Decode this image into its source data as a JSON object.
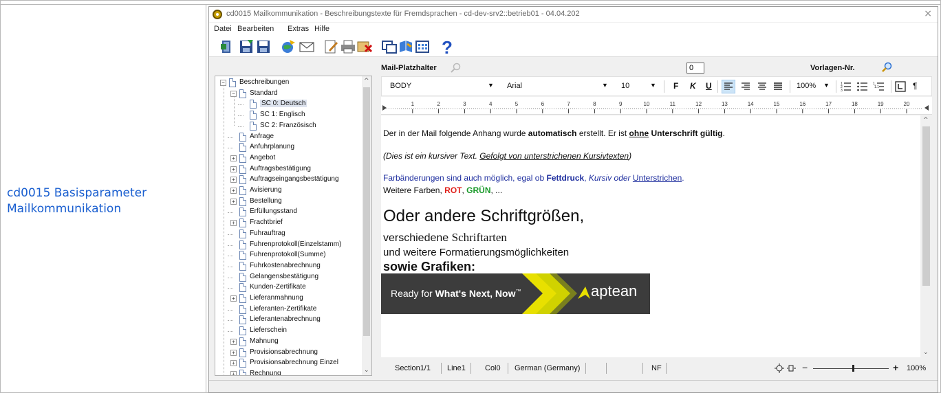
{
  "wiki": {
    "link_line1": "cd0015 Basisparameter",
    "link_line2": "Mailkommunikation"
  },
  "window": {
    "title": "cd0015 Mailkommunikation - Beschreibungstexte für Fremdsprachen - cd-dev-srv2::betrieb01 - 04.04.202",
    "close": "×"
  },
  "menu": [
    "Datei",
    "Bearbeiten",
    "Extras",
    "Hilfe"
  ],
  "editor_header": {
    "platzhalter_label": "Mail-Platzhalter",
    "vorlagen_label": "Vorlagen-Nr.",
    "vorlagen_value": "0"
  },
  "tree": {
    "root": "Beschreibungen",
    "standard": "Standard",
    "languages": [
      "SC 0: Deutsch",
      "SC 1: Englisch",
      "SC 2: Französisch"
    ],
    "items": [
      "Anfrage",
      "Anfuhrplanung",
      "Angebot",
      "Auftragsbestätigung",
      "Auftragseingangsbestätigung",
      "Avisierung",
      "Bestellung",
      "Erfüllungsstand",
      "Frachtbrief",
      "Fuhrauftrag",
      "Fuhrenprotokoll(Einzelstamm)",
      "Fuhrenprotokoll(Summe)",
      "Fuhrkostenabrechnung",
      "Gelangensbestätigung",
      "Kunden-Zertifikate",
      "Lieferanmahnung",
      "Lieferanten-Zertifikate",
      "Lieferantenabrechnung",
      "Lieferschein",
      "Mahnung",
      "Provisionsabrechnung",
      "Provisionsabrechnung Einzel",
      "Rechnung"
    ]
  },
  "format_bar": {
    "style": "BODY",
    "font": "Arial",
    "size": "10",
    "bold": "F",
    "italic": "K",
    "underline": "U",
    "zoom": "100%",
    "pilcrow": "¶"
  },
  "ruler": [
    "1",
    "2",
    "3",
    "4",
    "5",
    "6",
    "7",
    "8",
    "9",
    "10",
    "11",
    "12",
    "13",
    "14",
    "15",
    "16",
    "17",
    "18",
    "19",
    "20"
  ],
  "document": {
    "line1_a": "Der in der Mail folgende Anhang wurde ",
    "line1_b": "automatisch",
    "line1_c": " erstellt. Er ist ",
    "line1_d": "ohne",
    "line1_e": " Unterschrift gültig",
    "line1_f": ".",
    "line2_a": "(Dies ist ein kursiver Text. ",
    "line2_b": "Gefolgt von unterstrichenen Kursivtexten",
    "line2_c": ")",
    "line3_a": "Farbänderungen sind auch möglich, egal ob ",
    "line3_b": "Fettdruck",
    "line3_c": ", ",
    "line3_d": "Kursiv oder ",
    "line3_e": "Unterstrichen",
    "line3_f": ".",
    "line4_a": "Weitere Farben, ",
    "line4_b": "ROT",
    "line4_c": ", ",
    "line4_d": "GRÜN",
    "line4_e": ", ...",
    "line5": "Oder andere Schriftgrößen,",
    "line6_a": "verschiedene ",
    "line6_b": "Schriftarten",
    "line7": "und weitere Formatierungsmöglichkeiten",
    "line8": "sowie Grafiken:",
    "banner_a": "Ready for ",
    "banner_b": "What's Next, Now",
    "banner_tm": "™",
    "banner_logo": "aptean"
  },
  "status": {
    "section": "Section1/1",
    "line": "Line1",
    "col": "Col0",
    "language": "German (Germany)",
    "nf": "NF",
    "zoom_minus": "−",
    "zoom_plus": "+",
    "zoom_value": "100%"
  },
  "colors": {
    "link": "#1a5fd0",
    "blue_text": "#1f2f9f",
    "red": "#e0201a",
    "green": "#1a9a2a",
    "banner_bg": "#3c3c3c",
    "banner_yellow": "#e8e000"
  }
}
